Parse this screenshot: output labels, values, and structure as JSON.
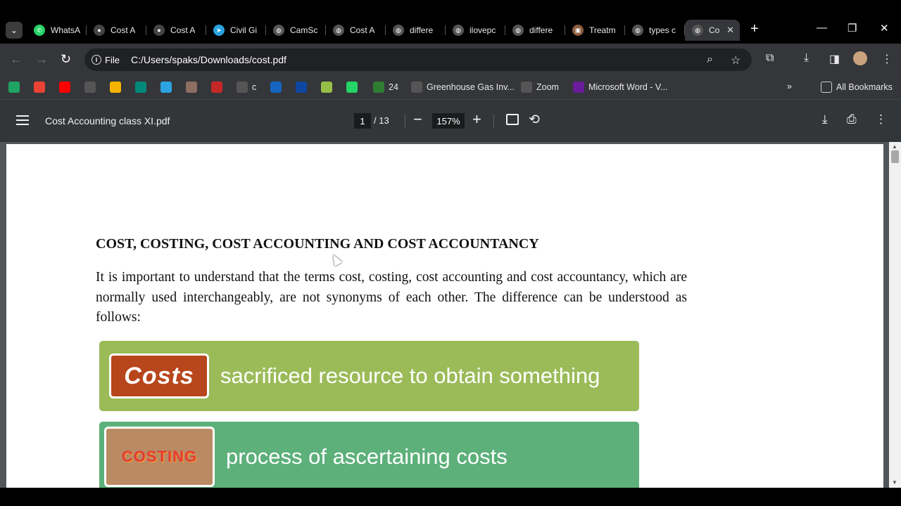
{
  "browser": {
    "tabs": [
      {
        "label": "WhatsA",
        "icon": "whatsapp-icon",
        "color": "#25d366",
        "glyph": "✆"
      },
      {
        "label": "Cost A",
        "icon": "site-dot-icon",
        "color": "#444",
        "glyph": "●"
      },
      {
        "label": "Cost A",
        "icon": "site-dot-icon",
        "color": "#444",
        "glyph": "●"
      },
      {
        "label": "Civil Gi",
        "icon": "telegram-icon",
        "color": "#2aa3e0",
        "glyph": "➤"
      },
      {
        "label": "CamSc",
        "icon": "globe-icon",
        "color": "#555",
        "glyph": "◍"
      },
      {
        "label": "Cost A",
        "icon": "globe-icon",
        "color": "#555",
        "glyph": "◍"
      },
      {
        "label": "differe",
        "icon": "globe-icon",
        "color": "#555",
        "glyph": "◍"
      },
      {
        "label": "ilovepc",
        "icon": "globe-icon",
        "color": "#555",
        "glyph": "◍"
      },
      {
        "label": "differe",
        "icon": "globe-icon",
        "color": "#555",
        "glyph": "◍"
      },
      {
        "label": "Treatm",
        "icon": "site-logo-icon",
        "color": "#8a5a3c",
        "glyph": "▣"
      },
      {
        "label": "types c",
        "icon": "globe-icon",
        "color": "#555",
        "glyph": "◍"
      }
    ],
    "active_tab": {
      "label": "Co",
      "icon": "globe-icon"
    },
    "url_chip": "File",
    "url": "C:/Users/spaks/Downloads/cost.pdf",
    "bookmarks": [
      {
        "label": "",
        "icon": "google-drive-icon",
        "color": "#1fa463"
      },
      {
        "label": "",
        "icon": "gmail-icon",
        "color": "#ea4335"
      },
      {
        "label": "",
        "icon": "youtube-icon",
        "color": "#ff0000"
      },
      {
        "label": "",
        "icon": "download-icon",
        "color": "#555"
      },
      {
        "label": "",
        "icon": "classroom-icon",
        "color": "#f4b400"
      },
      {
        "label": "",
        "icon": "meet-icon",
        "color": "#00897b"
      },
      {
        "label": "",
        "icon": "telegram-icon",
        "color": "#2aa3e0"
      },
      {
        "label": "",
        "icon": "profile-icon",
        "color": "#8d6e63"
      },
      {
        "label": "",
        "icon": "red-logo-icon",
        "color": "#c62828"
      },
      {
        "label": "c",
        "icon": "globe-icon",
        "color": "#555"
      },
      {
        "label": "",
        "icon": "app-a-icon",
        "color": "#1565c0"
      },
      {
        "label": "",
        "icon": "app-book-icon",
        "color": "#0d47a1"
      },
      {
        "label": "",
        "icon": "shopify-icon",
        "color": "#95bf47"
      },
      {
        "label": "",
        "icon": "whatsapp-icon",
        "color": "#25d366"
      },
      {
        "label": "24",
        "icon": "app-24-icon",
        "color": "#2e7d32"
      },
      {
        "label": "Greenhouse Gas Inv...",
        "icon": "globe-icon",
        "color": "#555"
      },
      {
        "label": "Zoom",
        "icon": "globe-icon",
        "color": "#555"
      },
      {
        "label": "Microsoft Word - V...",
        "icon": "ipcc-icon",
        "color": "#6a1b9a"
      }
    ],
    "all_bookmarks": "All Bookmarks"
  },
  "pdf": {
    "title": "Cost Accounting class XI.pdf",
    "current_page": "1",
    "total_pages": "/ 13",
    "zoom": "157%"
  },
  "document": {
    "heading": "COST, COSTING, COST ACCOUNTING AND COST ACCOUNTANCY",
    "paragraph": "It is important to understand that the terms cost, costing, cost accounting and cost accountancy, which are normally used interchangeably, are not synonyms of each other. The difference can be understood as follows:",
    "cards": [
      {
        "image_text": "Costs",
        "text": "sacrificed resource to obtain something"
      },
      {
        "image_text": "COSTING",
        "text": "process of ascertaining costs"
      }
    ]
  },
  "colors": {
    "card1": "#9bbb59",
    "card2": "#5db07a",
    "chrome_dark": "#35363a",
    "pdf_toolbar": "#323639"
  }
}
